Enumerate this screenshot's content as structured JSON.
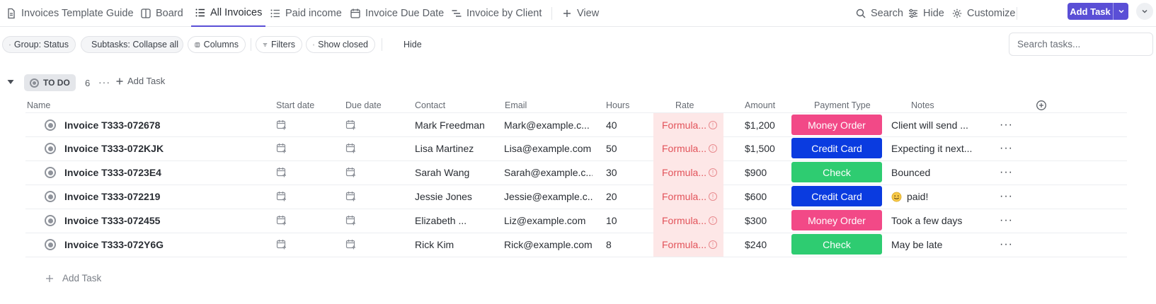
{
  "views": [
    {
      "label": "Invoices Template Guide",
      "icon": "doc-icon"
    },
    {
      "label": "Board",
      "icon": "board-icon"
    },
    {
      "label": "All Invoices",
      "icon": "list-icon",
      "active": true
    },
    {
      "label": "Paid income",
      "icon": "list-icon"
    },
    {
      "label": "Invoice Due Date",
      "icon": "calendar-icon"
    },
    {
      "label": "Invoice by Client",
      "icon": "gantt-icon"
    },
    {
      "label": "View",
      "icon": "plus-icon"
    }
  ],
  "tools": {
    "search": "Search",
    "hide": "Hide",
    "customize": "Customize",
    "add_task": "Add Task"
  },
  "filters": {
    "group": "Group: Status",
    "subtasks": "Subtasks: Collapse all",
    "columns": "Columns",
    "filters": "Filters",
    "show_closed": "Show closed",
    "hide": "Hide",
    "search_placeholder": "Search tasks..."
  },
  "group": {
    "status": "TO DO",
    "count": "6",
    "add_task": "Add Task"
  },
  "columns": [
    "Name",
    "Start date",
    "Due date",
    "Contact",
    "Email",
    "Hours",
    "Rate",
    "Amount",
    "Payment Type",
    "Notes"
  ],
  "rows": [
    {
      "name": "Invoice T333-072678",
      "contact": "Mark Freedman",
      "email": "Mark@example.c...",
      "hours": "40",
      "rate": "Formula...",
      "amount": "$1,200",
      "payment": "Money Order",
      "notes": "Client will send ..."
    },
    {
      "name": "Invoice T333-072KJK",
      "contact": "Lisa Martinez",
      "email": "Lisa@example.com",
      "hours": "50",
      "rate": "Formula...",
      "amount": "$1,500",
      "payment": "Credit Card",
      "notes": "Expecting it next..."
    },
    {
      "name": "Invoice T333-0723E4",
      "contact": "Sarah Wang",
      "email": "Sarah@example.c...",
      "hours": "30",
      "rate": "Formula...",
      "amount": "$900",
      "payment": "Check",
      "notes": "Bounced"
    },
    {
      "name": "Invoice T333-072219",
      "contact": "Jessie Jones",
      "email": "Jessie@example.c...",
      "hours": "20",
      "rate": "Formula...",
      "amount": "$600",
      "payment": "Credit Card",
      "notes": "paid!",
      "notes_emoji": "smile-emoji-icon"
    },
    {
      "name": "Invoice T333-072455",
      "contact": "Elizabeth ...",
      "email": "Liz@example.com",
      "hours": "10",
      "rate": "Formula...",
      "amount": "$300",
      "payment": "Money Order",
      "notes": "Took a few days"
    },
    {
      "name": "Invoice T333-072Y6G",
      "contact": "Rick Kim",
      "email": "Rick@example.com",
      "hours": "8",
      "rate": "Formula...",
      "amount": "$240",
      "payment": "Check",
      "notes": "May be late"
    }
  ],
  "payment_colors": {
    "Money Order": "#f24987",
    "Credit Card": "#0a3be0",
    "Check": "#2ecc71"
  },
  "accent_color": "#5a4fd6",
  "bottom_add": "Add Task"
}
